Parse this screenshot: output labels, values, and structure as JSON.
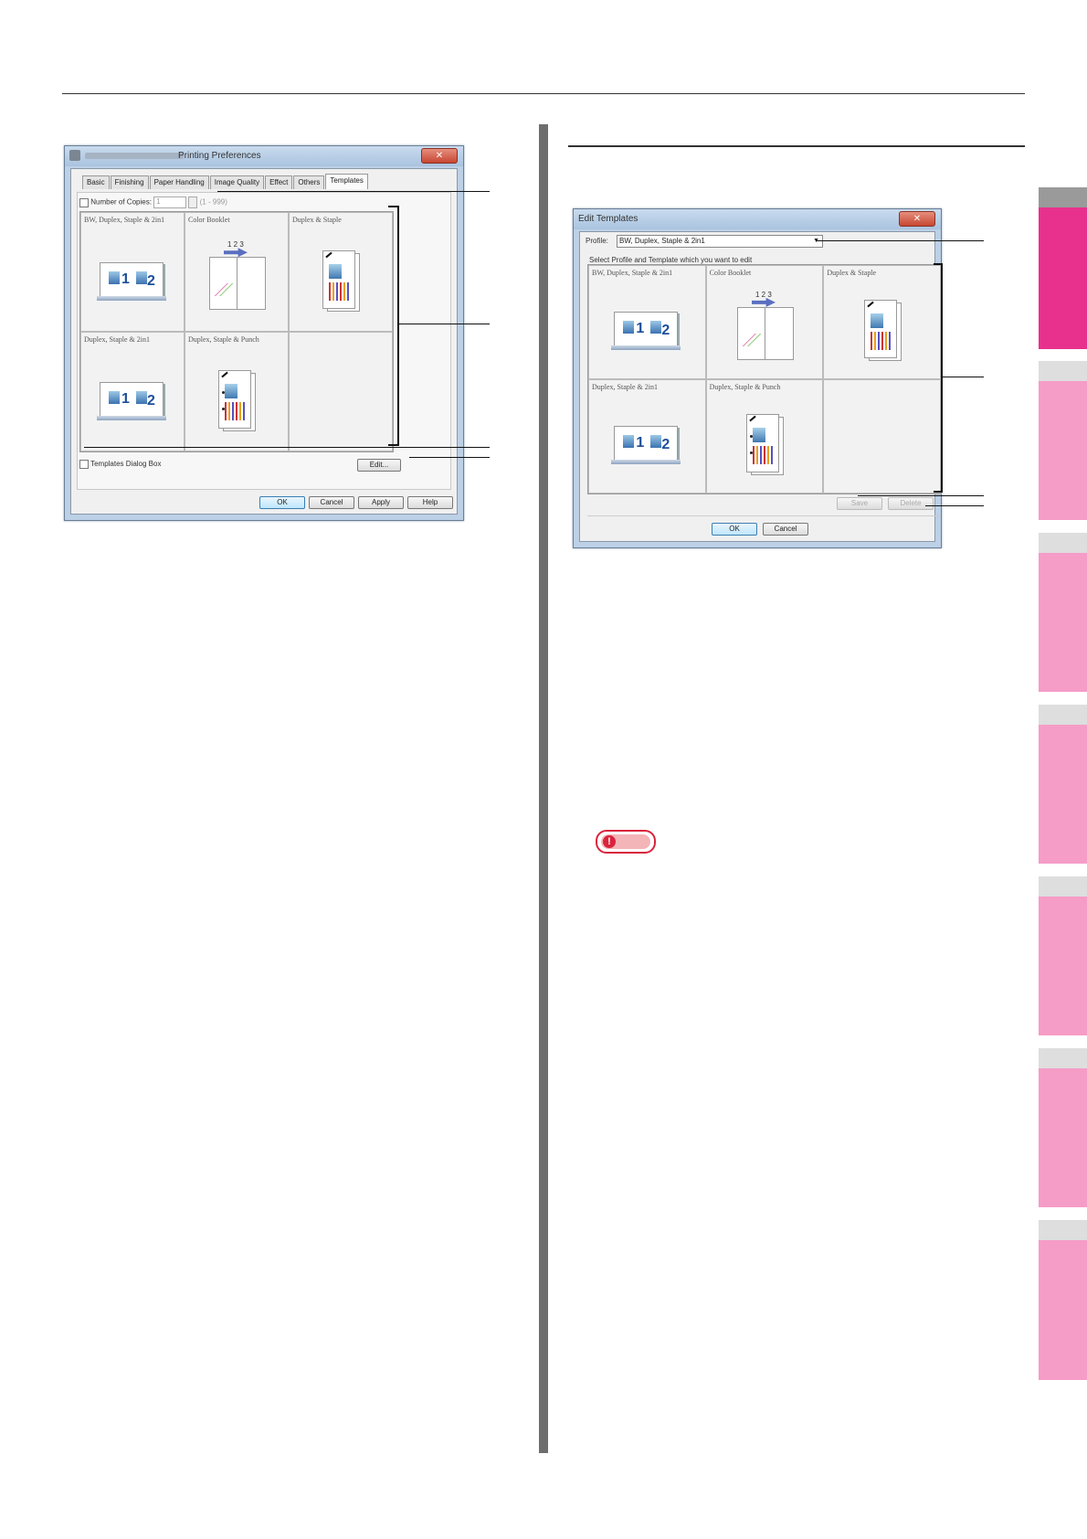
{
  "left_dialog": {
    "title": "Printing Preferences",
    "tabs": [
      "Basic",
      "Finishing",
      "Paper Handling",
      "Image Quality",
      "Effect",
      "Others",
      "Templates"
    ],
    "copies_label": "Number of Copies:",
    "copies_value": "1",
    "copies_range": "(1 - 999)",
    "templates": [
      "BW, Duplex, Staple & 2in1",
      "Color Booklet",
      "Duplex & Staple",
      "Duplex, Staple & 2in1",
      "Duplex, Staple & Punch",
      ""
    ],
    "templates_dialog_label": "Templates Dialog Box",
    "edit_label": "Edit...",
    "ok_label": "OK",
    "cancel_label": "Cancel",
    "apply_label": "Apply",
    "help_label": "Help",
    "close_label": "✕"
  },
  "right_dialog": {
    "title": "Edit Templates",
    "profile_label": "Profile:",
    "profile_value": "BW, Duplex, Staple & 2in1",
    "instruction": "Select Profile and Template which you want to edit",
    "templates": [
      "BW, Duplex, Staple & 2in1",
      "Color Booklet",
      "Duplex & Staple",
      "Duplex, Staple & 2in1",
      "Duplex, Staple & Punch",
      ""
    ],
    "save_label": "Save",
    "delete_label": "Delete",
    "ok_label": "OK",
    "cancel_label": "Cancel",
    "close_label": "✕"
  },
  "booklet_numbers": "1 2 3",
  "note_icon": "!",
  "colors": {
    "side_tab_active": "#e8318c",
    "side_tab": "#f59cc7",
    "note_red": "#d9243c"
  }
}
